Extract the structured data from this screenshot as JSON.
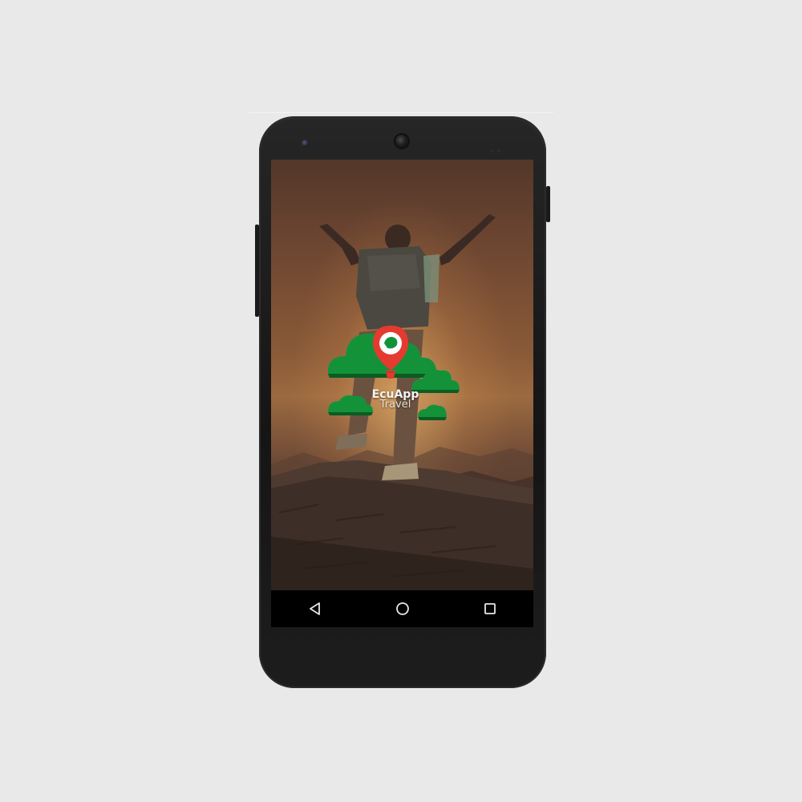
{
  "app": {
    "name_line1": "EcuApp",
    "name_line2": "Travel"
  },
  "colors": {
    "brand_green": "#139a3a",
    "pin_red": "#e53a2f",
    "wallpaper_warm": "#8a5a38"
  },
  "icons": {
    "nav_back": "back-triangle-icon",
    "nav_home": "home-circle-icon",
    "nav_recents": "recents-square-icon",
    "logo": "map-pin-balloon-icon"
  }
}
